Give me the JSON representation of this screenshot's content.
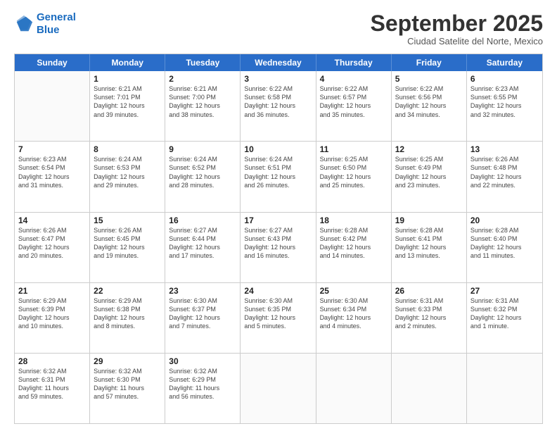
{
  "header": {
    "logo_line1": "General",
    "logo_line2": "Blue",
    "month": "September 2025",
    "location": "Ciudad Satelite del Norte, Mexico"
  },
  "days_of_week": [
    "Sunday",
    "Monday",
    "Tuesday",
    "Wednesday",
    "Thursday",
    "Friday",
    "Saturday"
  ],
  "weeks": [
    [
      {
        "day": "",
        "info": ""
      },
      {
        "day": "1",
        "info": "Sunrise: 6:21 AM\nSunset: 7:01 PM\nDaylight: 12 hours\nand 39 minutes."
      },
      {
        "day": "2",
        "info": "Sunrise: 6:21 AM\nSunset: 7:00 PM\nDaylight: 12 hours\nand 38 minutes."
      },
      {
        "day": "3",
        "info": "Sunrise: 6:22 AM\nSunset: 6:58 PM\nDaylight: 12 hours\nand 36 minutes."
      },
      {
        "day": "4",
        "info": "Sunrise: 6:22 AM\nSunset: 6:57 PM\nDaylight: 12 hours\nand 35 minutes."
      },
      {
        "day": "5",
        "info": "Sunrise: 6:22 AM\nSunset: 6:56 PM\nDaylight: 12 hours\nand 34 minutes."
      },
      {
        "day": "6",
        "info": "Sunrise: 6:23 AM\nSunset: 6:55 PM\nDaylight: 12 hours\nand 32 minutes."
      }
    ],
    [
      {
        "day": "7",
        "info": "Sunrise: 6:23 AM\nSunset: 6:54 PM\nDaylight: 12 hours\nand 31 minutes."
      },
      {
        "day": "8",
        "info": "Sunrise: 6:24 AM\nSunset: 6:53 PM\nDaylight: 12 hours\nand 29 minutes."
      },
      {
        "day": "9",
        "info": "Sunrise: 6:24 AM\nSunset: 6:52 PM\nDaylight: 12 hours\nand 28 minutes."
      },
      {
        "day": "10",
        "info": "Sunrise: 6:24 AM\nSunset: 6:51 PM\nDaylight: 12 hours\nand 26 minutes."
      },
      {
        "day": "11",
        "info": "Sunrise: 6:25 AM\nSunset: 6:50 PM\nDaylight: 12 hours\nand 25 minutes."
      },
      {
        "day": "12",
        "info": "Sunrise: 6:25 AM\nSunset: 6:49 PM\nDaylight: 12 hours\nand 23 minutes."
      },
      {
        "day": "13",
        "info": "Sunrise: 6:26 AM\nSunset: 6:48 PM\nDaylight: 12 hours\nand 22 minutes."
      }
    ],
    [
      {
        "day": "14",
        "info": "Sunrise: 6:26 AM\nSunset: 6:47 PM\nDaylight: 12 hours\nand 20 minutes."
      },
      {
        "day": "15",
        "info": "Sunrise: 6:26 AM\nSunset: 6:45 PM\nDaylight: 12 hours\nand 19 minutes."
      },
      {
        "day": "16",
        "info": "Sunrise: 6:27 AM\nSunset: 6:44 PM\nDaylight: 12 hours\nand 17 minutes."
      },
      {
        "day": "17",
        "info": "Sunrise: 6:27 AM\nSunset: 6:43 PM\nDaylight: 12 hours\nand 16 minutes."
      },
      {
        "day": "18",
        "info": "Sunrise: 6:28 AM\nSunset: 6:42 PM\nDaylight: 12 hours\nand 14 minutes."
      },
      {
        "day": "19",
        "info": "Sunrise: 6:28 AM\nSunset: 6:41 PM\nDaylight: 12 hours\nand 13 minutes."
      },
      {
        "day": "20",
        "info": "Sunrise: 6:28 AM\nSunset: 6:40 PM\nDaylight: 12 hours\nand 11 minutes."
      }
    ],
    [
      {
        "day": "21",
        "info": "Sunrise: 6:29 AM\nSunset: 6:39 PM\nDaylight: 12 hours\nand 10 minutes."
      },
      {
        "day": "22",
        "info": "Sunrise: 6:29 AM\nSunset: 6:38 PM\nDaylight: 12 hours\nand 8 minutes."
      },
      {
        "day": "23",
        "info": "Sunrise: 6:30 AM\nSunset: 6:37 PM\nDaylight: 12 hours\nand 7 minutes."
      },
      {
        "day": "24",
        "info": "Sunrise: 6:30 AM\nSunset: 6:35 PM\nDaylight: 12 hours\nand 5 minutes."
      },
      {
        "day": "25",
        "info": "Sunrise: 6:30 AM\nSunset: 6:34 PM\nDaylight: 12 hours\nand 4 minutes."
      },
      {
        "day": "26",
        "info": "Sunrise: 6:31 AM\nSunset: 6:33 PM\nDaylight: 12 hours\nand 2 minutes."
      },
      {
        "day": "27",
        "info": "Sunrise: 6:31 AM\nSunset: 6:32 PM\nDaylight: 12 hours\nand 1 minute."
      }
    ],
    [
      {
        "day": "28",
        "info": "Sunrise: 6:32 AM\nSunset: 6:31 PM\nDaylight: 11 hours\nand 59 minutes."
      },
      {
        "day": "29",
        "info": "Sunrise: 6:32 AM\nSunset: 6:30 PM\nDaylight: 11 hours\nand 57 minutes."
      },
      {
        "day": "30",
        "info": "Sunrise: 6:32 AM\nSunset: 6:29 PM\nDaylight: 11 hours\nand 56 minutes."
      },
      {
        "day": "",
        "info": ""
      },
      {
        "day": "",
        "info": ""
      },
      {
        "day": "",
        "info": ""
      },
      {
        "day": "",
        "info": ""
      }
    ]
  ]
}
